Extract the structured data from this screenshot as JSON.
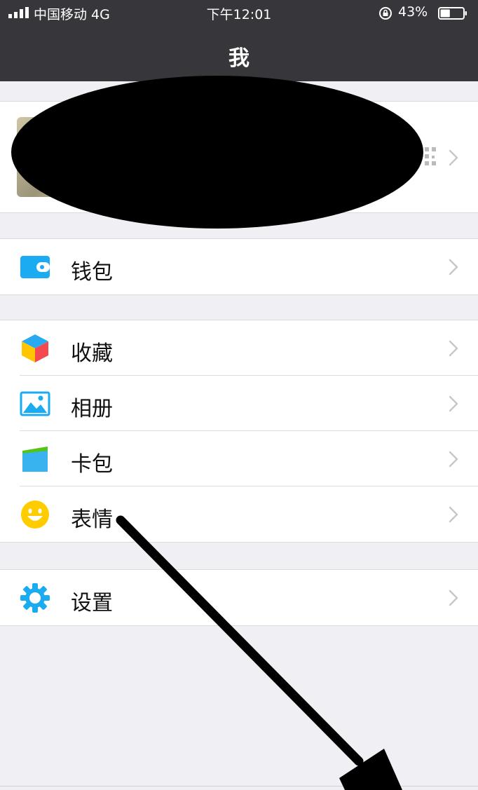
{
  "status": {
    "carrier": "中国移动   4G",
    "time": "下午12:01",
    "battery": "43%",
    "battery_level": 0.43
  },
  "nav": {
    "title": "我"
  },
  "menu": {
    "wallet": {
      "label": "钱包",
      "icon": "wallet-icon",
      "color": "#1aabf1"
    },
    "favorites": {
      "label": "收藏",
      "icon": "cube-icon"
    },
    "album": {
      "label": "相册",
      "icon": "photo-icon",
      "color": "#1aabf1"
    },
    "cards": {
      "label": "卡包",
      "icon": "card-icon",
      "color": "#39b3f0"
    },
    "stickers": {
      "label": "表情",
      "icon": "smiley-icon",
      "color": "#ffcc00"
    },
    "settings": {
      "label": "设置",
      "icon": "gear-icon",
      "color": "#1aabf1"
    }
  },
  "colors": {
    "nav_bg": "#37373b",
    "page_bg": "#efeff4",
    "chevron": "#c7c7cc"
  }
}
